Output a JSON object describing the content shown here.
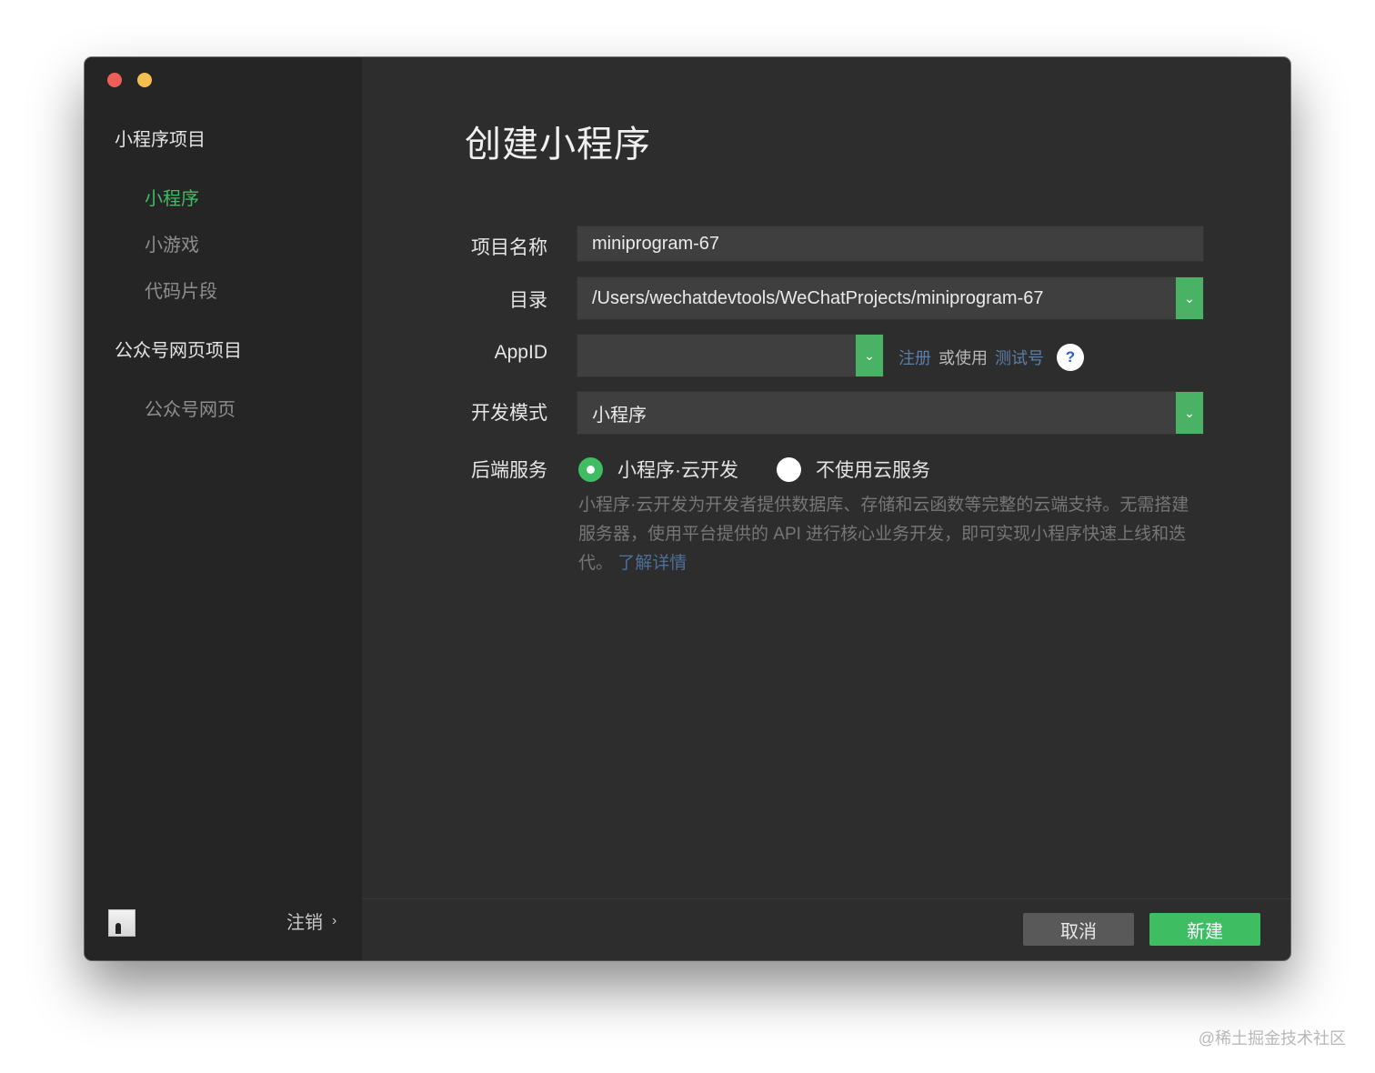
{
  "sidebar": {
    "group1": "小程序项目",
    "items1": [
      "小程序",
      "小游戏",
      "代码片段"
    ],
    "group2": "公众号网页项目",
    "items2": [
      "公众号网页"
    ],
    "logout_label": "注销",
    "logout_chevron": "›"
  },
  "main": {
    "title": "创建小程序",
    "project_name_label": "项目名称",
    "project_name_value": "miniprogram-67",
    "dir_label": "目录",
    "dir_value": "/Users/wechatdevtools/WeChatProjects/miniprogram-67",
    "appid_label": "AppID",
    "appid_value": "",
    "register_link": "注册",
    "or_use_text": "或使用",
    "test_account_link": "测试号",
    "help_glyph": "?",
    "dev_mode_label": "开发模式",
    "dev_mode_value": "小程序",
    "backend_label": "后端服务",
    "backend_options": [
      {
        "label": "小程序·云开发",
        "selected": true
      },
      {
        "label": "不使用云服务",
        "selected": false
      }
    ],
    "description": "小程序·云开发为开发者提供数据库、存储和云函数等完整的云端支持。无需搭建服务器，使用平台提供的 API 进行核心业务开发，即可实现小程序快速上线和迭代。",
    "learn_more": "了解详情",
    "cancel_button": "取消",
    "create_button": "新建"
  },
  "watermark": "@稀土掘金技术社区",
  "colors": {
    "accent": "#3fbd62",
    "link": "#5b7ea8",
    "window_bg": "#2d2d2e",
    "sidebar_bg": "#252526"
  },
  "icons": {
    "dropdown": "chevron-down-icon",
    "help": "question-icon",
    "logout": "chevron-right-icon"
  }
}
